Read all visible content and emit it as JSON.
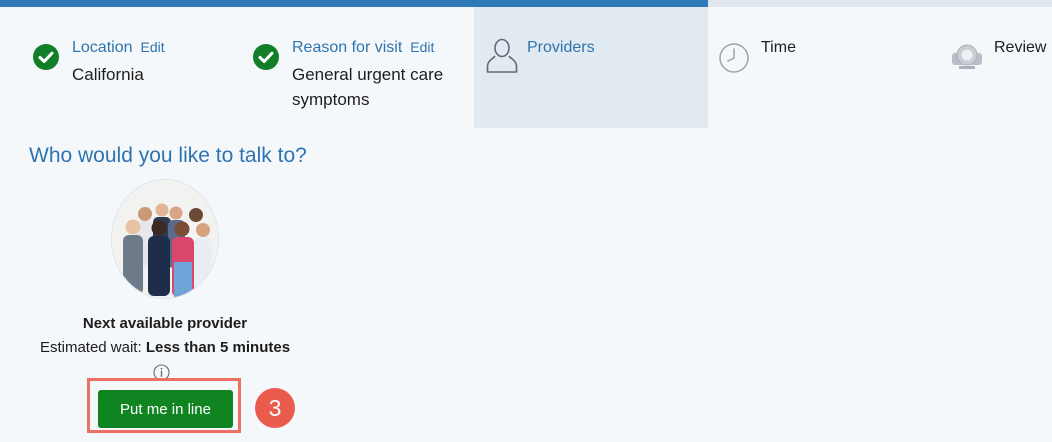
{
  "steps": [
    {
      "title": "Location",
      "edit_label": "Edit",
      "value": "California",
      "status": "complete"
    },
    {
      "title": "Reason for visit",
      "edit_label": "Edit",
      "value": "General urgent care symptoms",
      "status": "complete"
    },
    {
      "title": "Providers",
      "status": "active",
      "icon": "person-icon"
    },
    {
      "title": "Time",
      "status": "pending",
      "icon": "clock-icon"
    },
    {
      "title": "Review",
      "status": "pending",
      "icon": "webcam-icon"
    }
  ],
  "main": {
    "heading": "Who would you like to talk to?",
    "provider": {
      "name": "Next available provider",
      "wait_label": "Estimated wait:",
      "wait_value": "Less than 5 minutes",
      "button_label": "Put me in line"
    },
    "annotation_number": "3"
  },
  "colors": {
    "accent": "#2f74b0",
    "success": "#117f28",
    "button": "#0f8420",
    "highlight": "#ea7163",
    "badge": "#ea5a4d"
  }
}
